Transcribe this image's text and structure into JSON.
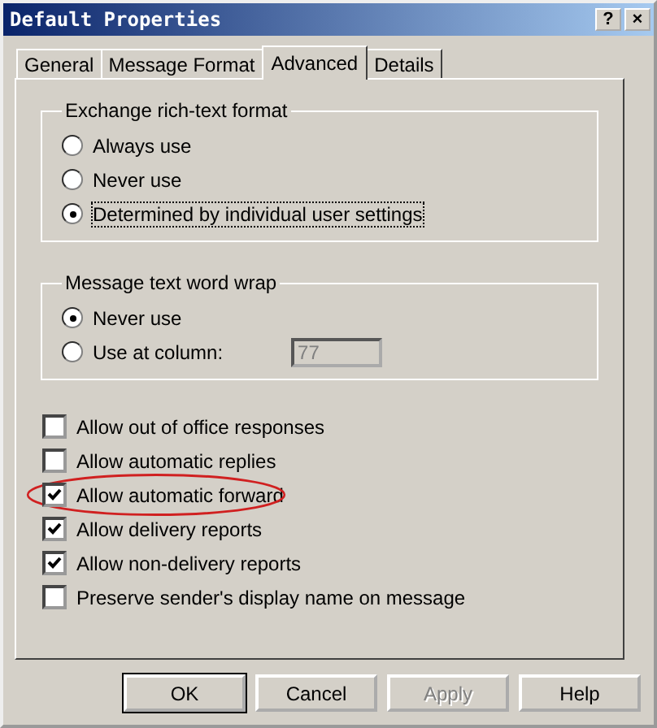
{
  "window": {
    "title": "Default Properties",
    "title_buttons": [
      "?",
      "×"
    ]
  },
  "tabs": [
    {
      "label": "General",
      "selected": false
    },
    {
      "label": "Message Format",
      "selected": false
    },
    {
      "label": "Advanced",
      "selected": true
    },
    {
      "label": "Details",
      "selected": false
    }
  ],
  "groups": [
    {
      "title": "Exchange rich-text format",
      "options": [
        {
          "label": "Always use",
          "selected": false,
          "focused": false
        },
        {
          "label": "Never use",
          "selected": false,
          "focused": false
        },
        {
          "label": "Determined by individual user settings",
          "selected": true,
          "focused": true
        }
      ]
    },
    {
      "title": "Message text word wrap",
      "options": [
        {
          "label": "Never use",
          "selected": true,
          "focused": false
        },
        {
          "label": "Use at column:",
          "selected": false,
          "focused": false,
          "field": {
            "value": "77",
            "disabled": true
          }
        }
      ]
    }
  ],
  "checkboxes": [
    {
      "label": "Allow out of office responses",
      "checked": false,
      "circled": false
    },
    {
      "label": "Allow automatic replies",
      "checked": false,
      "circled": false
    },
    {
      "label": "Allow automatic forward",
      "checked": true,
      "circled": true
    },
    {
      "label": "Allow delivery reports",
      "checked": true,
      "circled": false
    },
    {
      "label": "Allow non-delivery reports",
      "checked": true,
      "circled": false
    },
    {
      "label": "Preserve sender's display name on message",
      "checked": false,
      "circled": false
    }
  ],
  "buttons": [
    {
      "label": "OK",
      "default": true,
      "disabled": false
    },
    {
      "label": "Cancel",
      "default": false,
      "disabled": false
    },
    {
      "label": "Apply",
      "default": false,
      "disabled": true
    },
    {
      "label": "Help",
      "default": false,
      "disabled": false
    }
  ]
}
